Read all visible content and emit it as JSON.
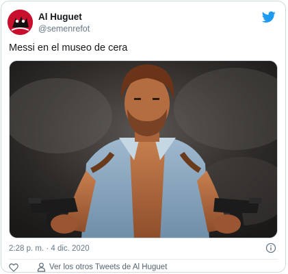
{
  "user": {
    "name": "Al Huguet",
    "handle": "@semenrefot",
    "avatar_icon": "avatar-image"
  },
  "tweet": {
    "text": "Messi en el museo de cera",
    "image_alt": "",
    "timestamp": "2:28 p. m. · 4 dic. 2020"
  },
  "actions": {
    "like_icon": "heart-icon",
    "more_tweets_icon": "person-icon",
    "more_tweets_label": "Ver los otros Tweets de Al Huguet",
    "info_icon": "info-icon"
  },
  "colors": {
    "twitter_blue": "#1d9bf0",
    "avatar_red": "#c8102e",
    "muted_text": "#657786"
  }
}
